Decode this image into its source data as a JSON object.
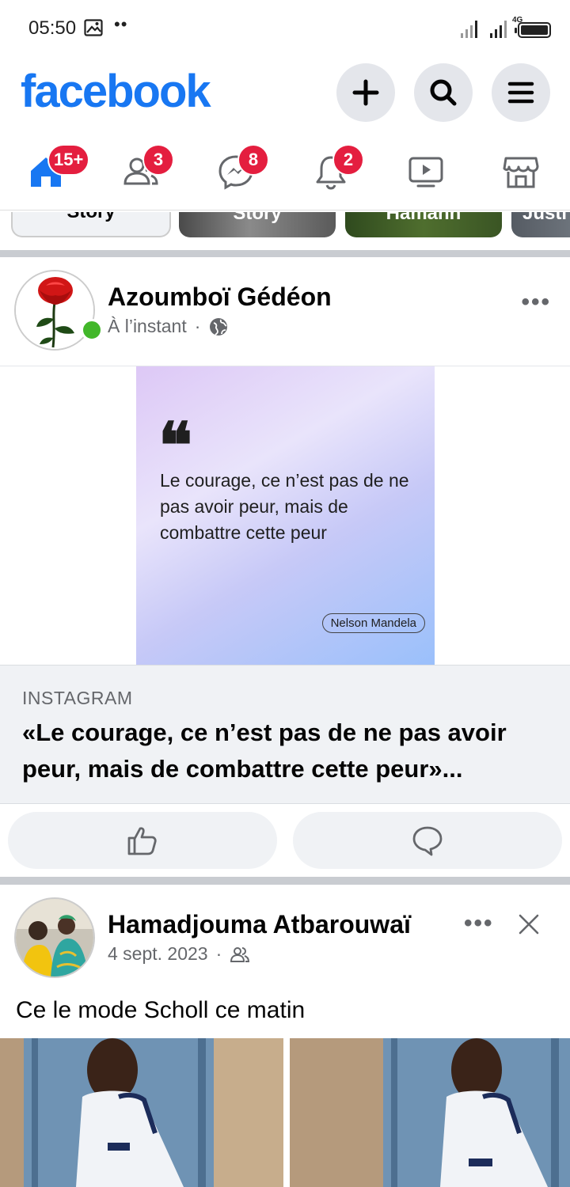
{
  "status_bar": {
    "time": "05:50",
    "dots": "••",
    "network_type": "4G"
  },
  "header": {
    "logo": "facebook",
    "brand_color": "#1877f2",
    "buttons": [
      "plus-icon",
      "search-icon",
      "menu-icon"
    ]
  },
  "tabs": [
    {
      "name": "home",
      "icon": "home-icon",
      "badge": "15+"
    },
    {
      "name": "friends",
      "icon": "friends-icon",
      "badge": "3"
    },
    {
      "name": "messenger",
      "icon": "messenger-icon",
      "badge": "8"
    },
    {
      "name": "notifications",
      "icon": "bell-icon",
      "badge": "2"
    },
    {
      "name": "watch",
      "icon": "video-icon",
      "badge": ""
    },
    {
      "name": "marketplace",
      "icon": "store-icon",
      "badge": ""
    }
  ],
  "stories": [
    {
      "label": "Story"
    },
    {
      "label": "Story"
    },
    {
      "label": "Hamann"
    },
    {
      "label": "Justi"
    }
  ],
  "post1": {
    "author": "Azoumboï Gédéon",
    "time": "À l’instant",
    "quote": {
      "text": "Le courage, ce n’est pas de ne pas avoir peur, mais de combattre cette peur",
      "author": "Nelson Mandela"
    },
    "link": {
      "source": "INSTAGRAM",
      "title": "«Le courage, ce n’est pas de ne pas avoir peur, mais de combattre cette peur»..."
    }
  },
  "post2": {
    "author": "Hamadjouma Atbarouwaï",
    "date": "4 sept. 2023",
    "text": "Ce le mode Scholl ce matin"
  },
  "colors": {
    "badge_red": "#e41e3f",
    "online_green": "#42b72a",
    "secondary_text": "#65676b"
  }
}
